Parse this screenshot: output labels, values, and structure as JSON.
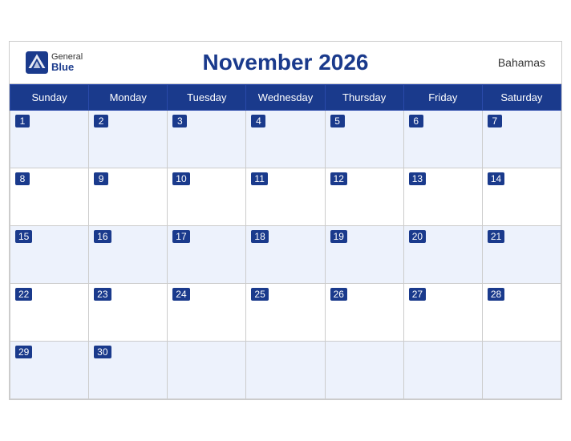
{
  "header": {
    "logo_general": "General",
    "logo_blue": "Blue",
    "title": "November 2026",
    "country": "Bahamas"
  },
  "weekdays": [
    "Sunday",
    "Monday",
    "Tuesday",
    "Wednesday",
    "Thursday",
    "Friday",
    "Saturday"
  ],
  "weeks": [
    [
      {
        "day": 1,
        "empty": false
      },
      {
        "day": 2,
        "empty": false
      },
      {
        "day": 3,
        "empty": false
      },
      {
        "day": 4,
        "empty": false
      },
      {
        "day": 5,
        "empty": false
      },
      {
        "day": 6,
        "empty": false
      },
      {
        "day": 7,
        "empty": false
      }
    ],
    [
      {
        "day": 8,
        "empty": false
      },
      {
        "day": 9,
        "empty": false
      },
      {
        "day": 10,
        "empty": false
      },
      {
        "day": 11,
        "empty": false
      },
      {
        "day": 12,
        "empty": false
      },
      {
        "day": 13,
        "empty": false
      },
      {
        "day": 14,
        "empty": false
      }
    ],
    [
      {
        "day": 15,
        "empty": false
      },
      {
        "day": 16,
        "empty": false
      },
      {
        "day": 17,
        "empty": false
      },
      {
        "day": 18,
        "empty": false
      },
      {
        "day": 19,
        "empty": false
      },
      {
        "day": 20,
        "empty": false
      },
      {
        "day": 21,
        "empty": false
      }
    ],
    [
      {
        "day": 22,
        "empty": false
      },
      {
        "day": 23,
        "empty": false
      },
      {
        "day": 24,
        "empty": false
      },
      {
        "day": 25,
        "empty": false
      },
      {
        "day": 26,
        "empty": false
      },
      {
        "day": 27,
        "empty": false
      },
      {
        "day": 28,
        "empty": false
      }
    ],
    [
      {
        "day": 29,
        "empty": false
      },
      {
        "day": 30,
        "empty": false
      },
      {
        "day": null,
        "empty": true
      },
      {
        "day": null,
        "empty": true
      },
      {
        "day": null,
        "empty": true
      },
      {
        "day": null,
        "empty": true
      },
      {
        "day": null,
        "empty": true
      }
    ]
  ],
  "colors": {
    "header_bg": "#1a3a8c",
    "row_odd": "#edf2fc",
    "row_even": "#ffffff",
    "day_number_bg": "#1a3a8c",
    "day_number_text": "#ffffff"
  }
}
